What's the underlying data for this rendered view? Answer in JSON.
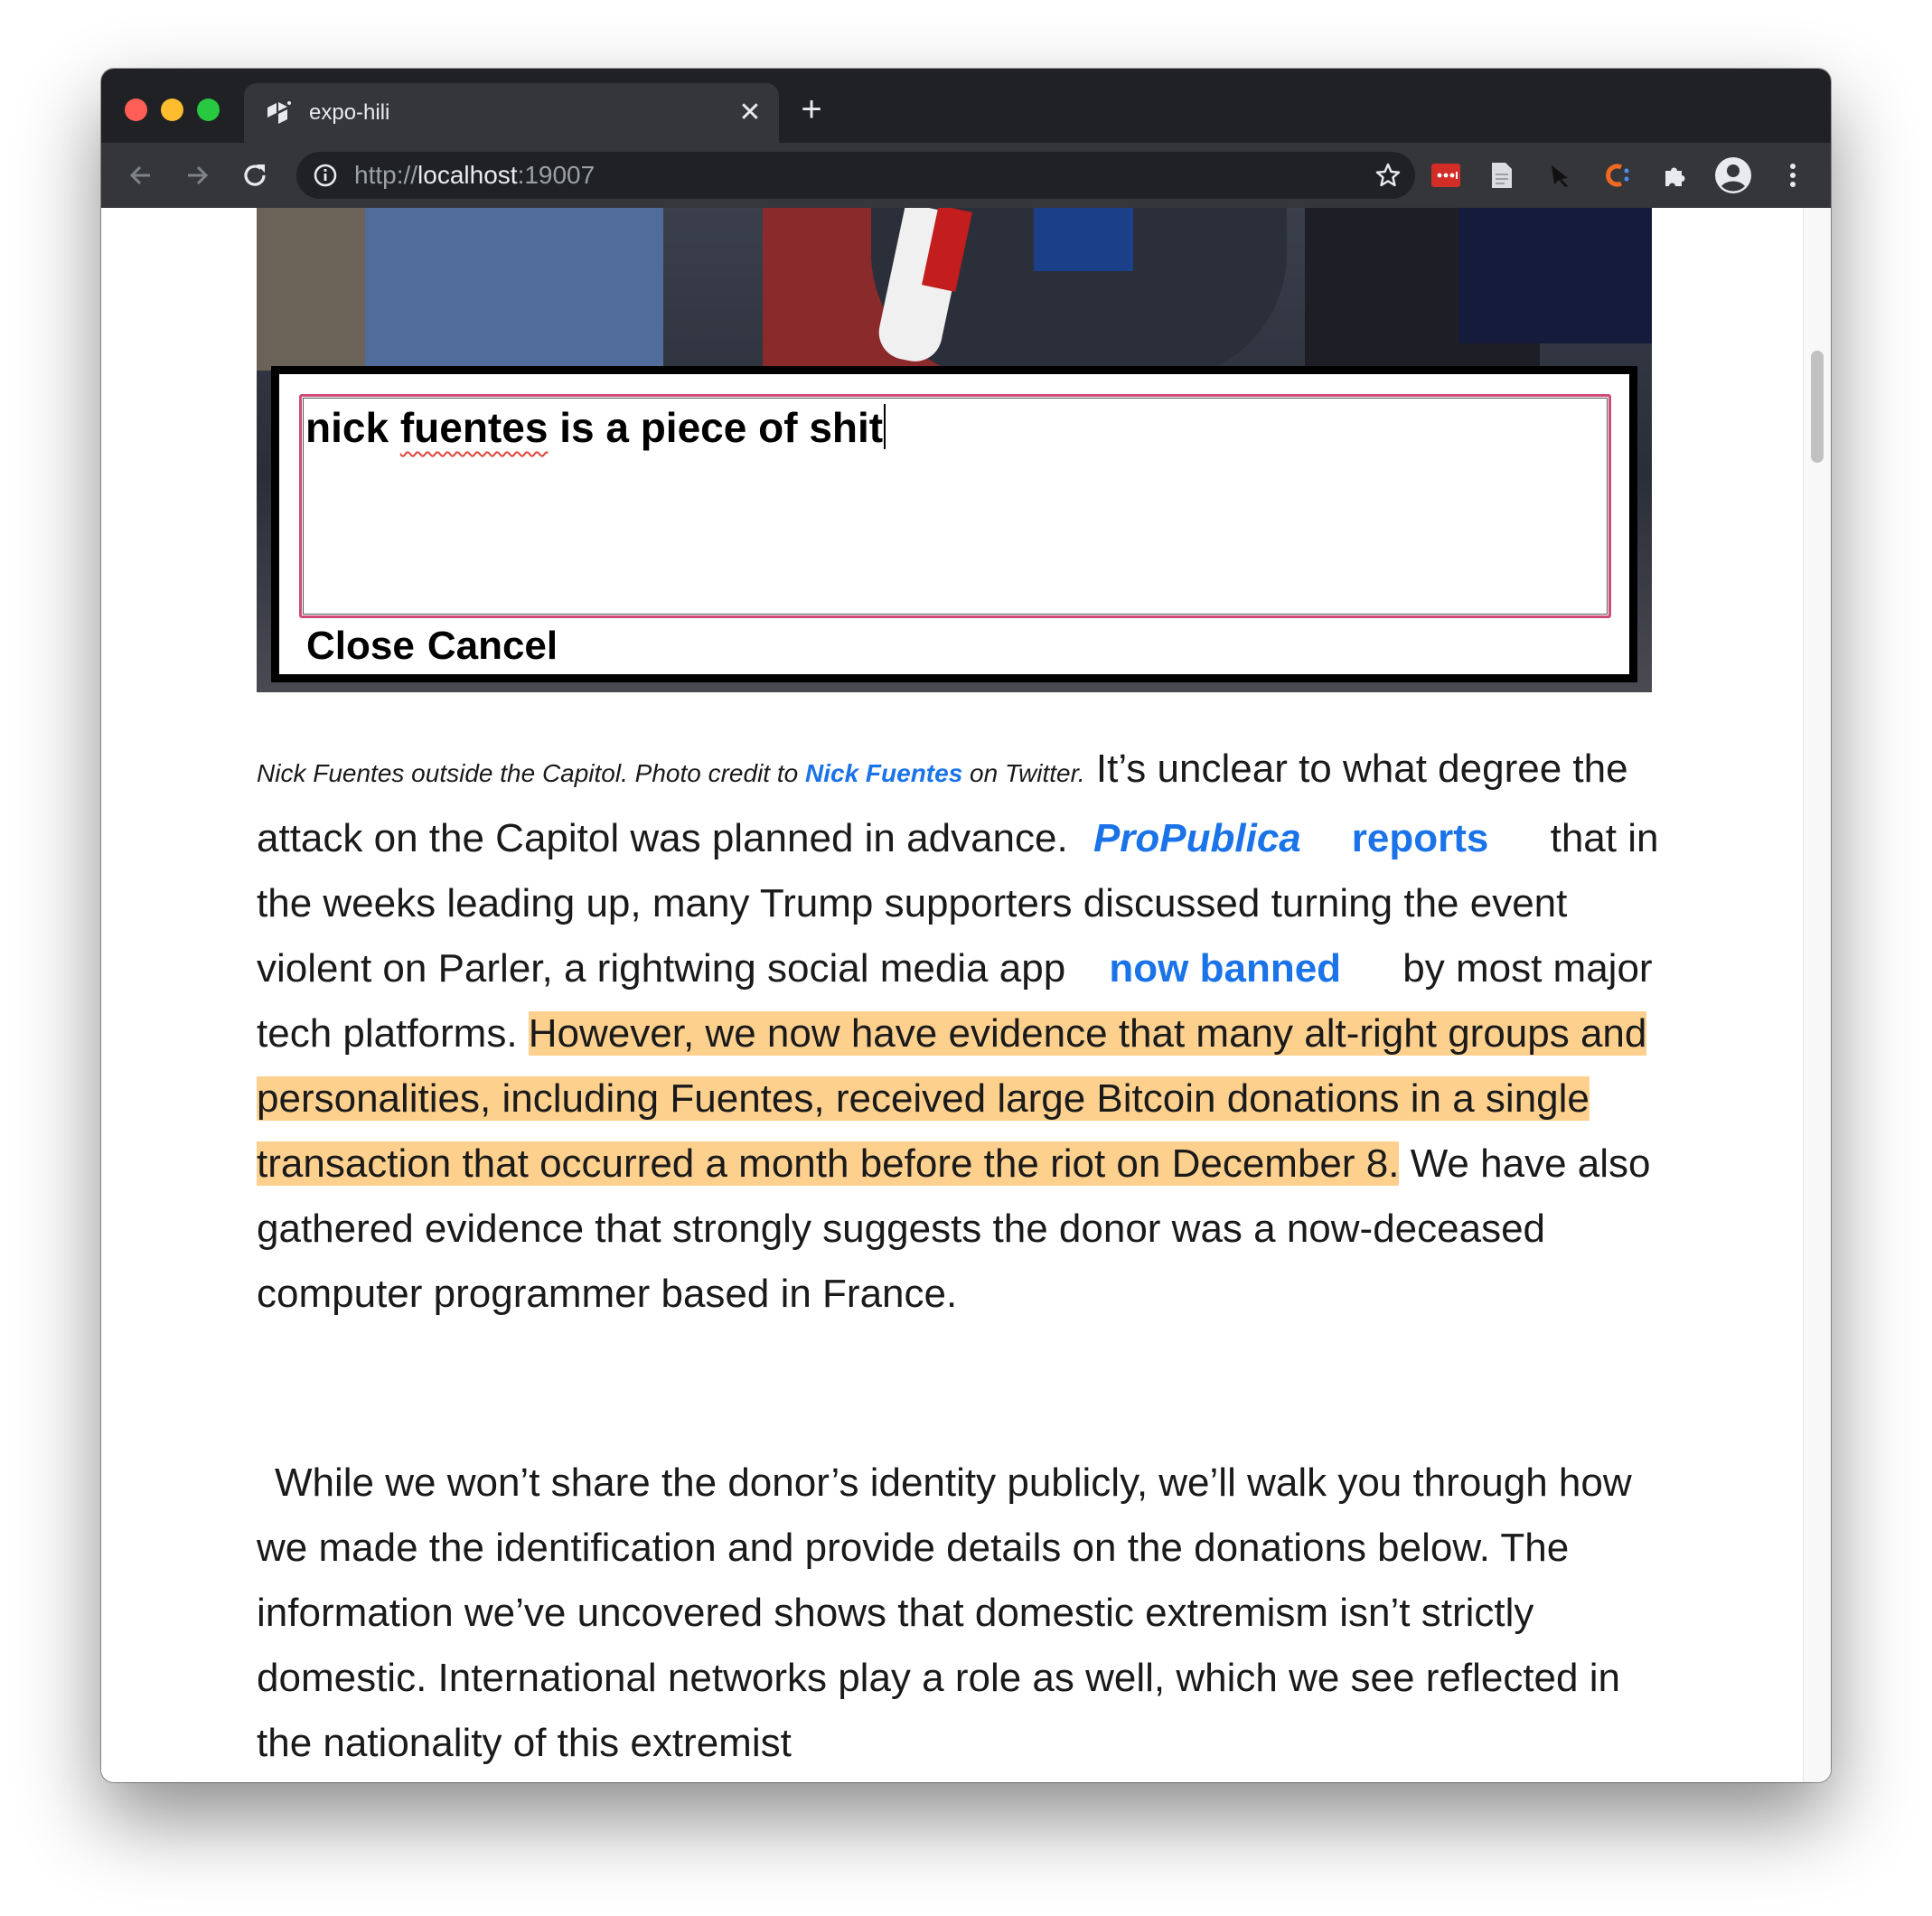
{
  "browser": {
    "tab_title": "expo-hili",
    "tab_close": "✕",
    "new_tab": "+",
    "url_scheme": "http://",
    "url_host": "localhost",
    "url_port": ":19007"
  },
  "modal": {
    "text_before": "nick ",
    "text_misspelled": "fuentes",
    "text_after": " is a piece of shit",
    "close_label": "Close",
    "cancel_label": "Cancel"
  },
  "article": {
    "caption_text": "Nick Fuentes outside the Capitol. Photo credit to ",
    "caption_link": "Nick Fuentes",
    "caption_end": " on Twitter.",
    "p1_a": " It’s unclear to what degree the attack on the Capitol was planned in advance. ",
    "link_propublica": "ProPublica",
    "link_reports": "reports",
    "p1_b": " that in the weeks leading up, many Trump supporters discussed turning the event violent on Parler, a rightwing social media app ",
    "link_banned": "now banned",
    "p1_c": " by most major tech platforms. ",
    "highlight": "However, we now have evidence that many alt-right groups and personalities, including Fuentes, received large Bitcoin donations in a single transaction that occurred a month before the riot on December 8.",
    "p1_d": " We have also gathered evidence that strongly suggests the donor was a now-deceased computer programmer based in France.",
    "p2": "While we won’t share the donor’s identity publicly, we’ll walk you through how we made the identification and provide details on the donations below. The information we’ve uncovered shows that domestic extremism isn’t strictly domestic. International networks play a role as well, which we see reflected in the nationality of this extremist"
  },
  "colors": {
    "highlight": "#fdd08e",
    "link": "#1a73e8",
    "input_border": "#d04a7a"
  },
  "icons": [
    "back-arrow-icon",
    "forward-arrow-icon",
    "reload-icon",
    "info-icon",
    "star-icon",
    "lastpass-icon",
    "document-icon",
    "pin-icon",
    "c-extension-icon",
    "puzzle-icon",
    "profile-icon",
    "menu-icon"
  ]
}
